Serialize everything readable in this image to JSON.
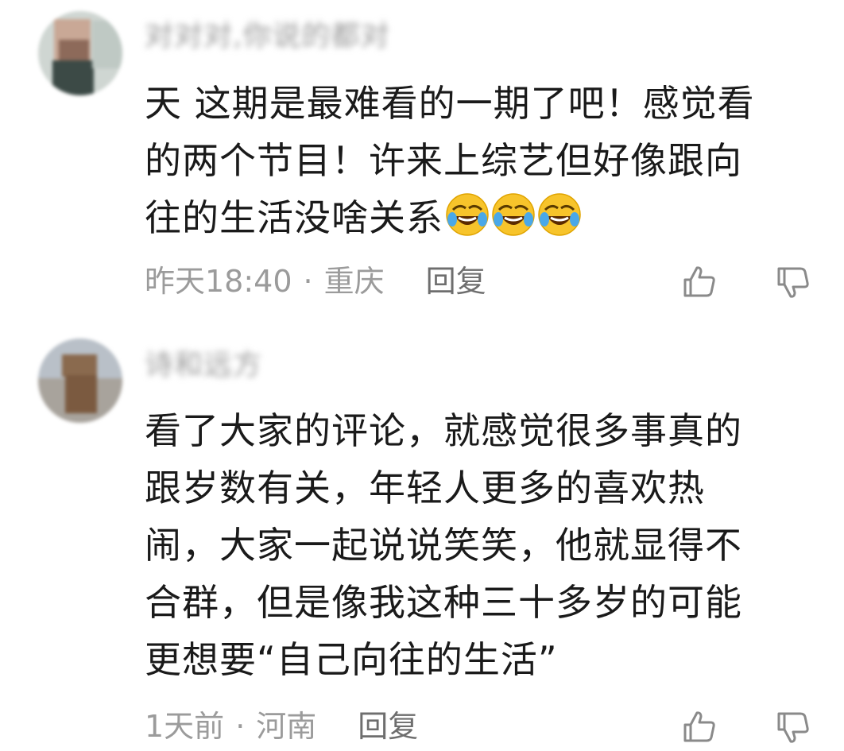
{
  "comments": [
    {
      "username": "对对对,你说的都对",
      "lines": [
        "天 这期是最难看的一期了吧！感觉看",
        "的两个节目！许来上综艺但好像跟向",
        "往的生活没啥关系"
      ],
      "emojis": [
        "rolling-on-floor-laughing-emoji",
        "rolling-on-floor-laughing-emoji",
        "rolling-on-floor-laughing-emoji"
      ],
      "time": "昨天18:40",
      "separator": "·",
      "location": "重庆",
      "reply_label": "回复"
    },
    {
      "username": "诗和远方",
      "lines": [
        "看了大家的评论，就感觉很多事真的",
        "跟岁数有关，年轻人更多的喜欢热",
        "闹，大家一起说说笑笑，他就显得不",
        "合群，但是像我这种三十多岁的可能",
        "更想要“自己向往的生活”"
      ],
      "emojis": [],
      "time": "1天前",
      "separator": "·",
      "location": "河南",
      "reply_label": "回复"
    }
  ],
  "icons": {
    "like": "thumbs-up-icon",
    "dislike": "thumbs-down-icon"
  },
  "colors": {
    "text": "#1a1a1a",
    "meta": "#9b9b9b",
    "reply": "#6e6e6e",
    "icon": "#8a8a8a"
  }
}
